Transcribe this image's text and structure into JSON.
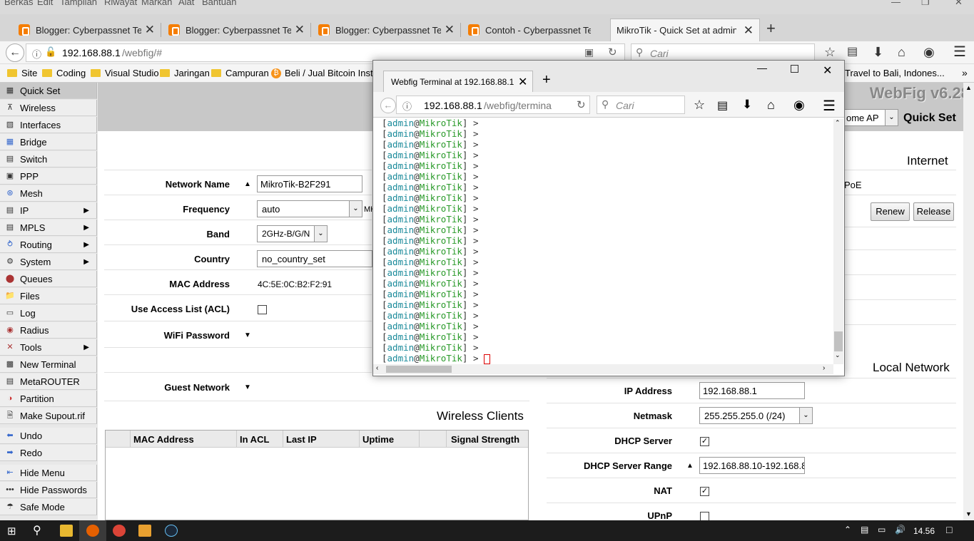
{
  "menubar": {
    "items": [
      "Berkas",
      "Edit",
      "Tampilan",
      "Riwayat",
      "Markah",
      "Alat",
      "Bantuan"
    ]
  },
  "tabs": [
    {
      "title": "Blogger: Cyberpassnet Tech",
      "active": false
    },
    {
      "title": "Blogger: Cyberpassnet Tech",
      "active": false
    },
    {
      "title": "Blogger: Cyberpassnet Tech",
      "active": false
    },
    {
      "title": "Contoh - Cyberpassnet Tech",
      "active": false
    },
    {
      "title": "MikroTik - Quick Set at admin@",
      "active": true
    }
  ],
  "nav": {
    "url_host": "192.168.88.1",
    "url_path": "/webfig/#",
    "search_placeholder": "Cari"
  },
  "bookmarks": [
    "Site",
    "Coding",
    "Visual Studio",
    "Jaringan",
    "Campuran",
    "Beli / Jual Bitcoin Insta...",
    "Travel to Bali, Indones..."
  ],
  "sidebar": {
    "items": [
      {
        "label": "Quick Set",
        "icon": "quickset-icon",
        "sub": false,
        "selected": true
      },
      {
        "label": "Wireless",
        "icon": "wireless-icon",
        "sub": false
      },
      {
        "label": "Interfaces",
        "icon": "interfaces-icon",
        "sub": false
      },
      {
        "label": "Bridge",
        "icon": "bridge-icon",
        "sub": false
      },
      {
        "label": "Switch",
        "icon": "switch-icon",
        "sub": false
      },
      {
        "label": "PPP",
        "icon": "ppp-icon",
        "sub": false
      },
      {
        "label": "Mesh",
        "icon": "mesh-icon",
        "sub": false
      },
      {
        "label": "IP",
        "icon": "ip-icon",
        "sub": true
      },
      {
        "label": "MPLS",
        "icon": "mpls-icon",
        "sub": true
      },
      {
        "label": "Routing",
        "icon": "routing-icon",
        "sub": true
      },
      {
        "label": "System",
        "icon": "system-icon",
        "sub": true
      },
      {
        "label": "Queues",
        "icon": "queues-icon",
        "sub": false
      },
      {
        "label": "Files",
        "icon": "files-icon",
        "sub": false
      },
      {
        "label": "Log",
        "icon": "log-icon",
        "sub": false
      },
      {
        "label": "Radius",
        "icon": "radius-icon",
        "sub": false
      },
      {
        "label": "Tools",
        "icon": "tools-icon",
        "sub": true
      },
      {
        "label": "New Terminal",
        "icon": "terminal-icon",
        "sub": false
      },
      {
        "label": "MetaROUTER",
        "icon": "metarouter-icon",
        "sub": false
      },
      {
        "label": "Partition",
        "icon": "partition-icon",
        "sub": false
      },
      {
        "label": "Make Supout.rif",
        "icon": "supout-icon",
        "sub": false
      }
    ],
    "bottom": [
      {
        "label": "Undo",
        "icon": "undo-icon"
      },
      {
        "label": "Redo",
        "icon": "redo-icon"
      },
      {
        "label": "Hide Menu",
        "icon": "hide-menu-icon"
      },
      {
        "label": "Hide Passwords",
        "icon": "hide-passwords-icon"
      },
      {
        "label": "Safe Mode",
        "icon": "safe-mode-icon"
      }
    ]
  },
  "header": {
    "brand": "WebFig v6.28",
    "mode_value": "ome AP",
    "quick_set": "Quick Set"
  },
  "wireless": {
    "network_name_label": "Network Name",
    "network_name": "MikroTik-B2F291",
    "frequency_label": "Frequency",
    "frequency": "auto",
    "frequency_unit": "MH",
    "band_label": "Band",
    "band": "2GHz-B/G/N",
    "country_label": "Country",
    "country": "no_country_set",
    "mac_label": "MAC Address",
    "mac": "4C:5E:0C:B2:F2:91",
    "acl_label": "Use Access List (ACL)",
    "wifi_password_label": "WiFi Password",
    "guest_network_label": "Guest Network"
  },
  "clients": {
    "title": "Wireless Clients",
    "columns": [
      "MAC Address",
      "In ACL",
      "Last IP",
      "Uptime",
      "Signal Strength"
    ]
  },
  "internet": {
    "title": "Internet",
    "poe_fragment": "PoE",
    "renew": "Renew",
    "release": "Release"
  },
  "local": {
    "title": "Local Network",
    "ip_label": "IP Address",
    "ip": "192.168.88.1",
    "netmask_label": "Netmask",
    "netmask": "255.255.255.0 (/24)",
    "dhcp_label": "DHCP Server",
    "range_label": "DHCP Server Range",
    "range": "192.168.88.10-192.168.8",
    "nat_label": "NAT",
    "upnp_label": "UPnP"
  },
  "popup": {
    "title": "Webfig Terminal at 192.168.88.1",
    "url_host": "192.168.88.1",
    "url_path": "/webfig/termina",
    "search_placeholder": "Cari",
    "prompt_user": "admin",
    "prompt_host": "MikroTik",
    "prompt_count": 23
  },
  "taskbar": {
    "time": "14.56"
  }
}
